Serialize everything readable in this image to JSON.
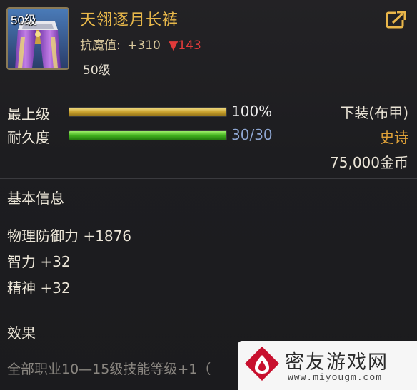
{
  "item": {
    "icon_level": "50级",
    "name": "天翎逐月长裤",
    "resist_label": "抗魔值:",
    "resist_value": "+310",
    "resist_down": "▼143",
    "required_level": "50级",
    "type": "下装(布甲)",
    "rarity": "史诗",
    "price": "75,000金币",
    "rarity_color": "#e0a238",
    "name_color": "#e8b84a"
  },
  "stats_bars": [
    {
      "label": "最上级",
      "value_text": "100%",
      "fill": 1.0,
      "color": "gold"
    },
    {
      "label": "耐久度",
      "value_text": "30/30",
      "fill": 1.0,
      "color": "green"
    }
  ],
  "basic_info": {
    "title": "基本信息",
    "lines": [
      "物理防御力 +1876",
      "智力 +32",
      "精神 +32"
    ]
  },
  "effect": {
    "title": "效果",
    "text": "全部职业10—15级技能等级+1（"
  },
  "icons": {
    "share": "share-export-icon",
    "item": "pants-item-icon",
    "watermark_logo": "miyou-logo-icon"
  },
  "watermark": {
    "title": "密友游戏网",
    "url": "www.miyougm.com"
  }
}
